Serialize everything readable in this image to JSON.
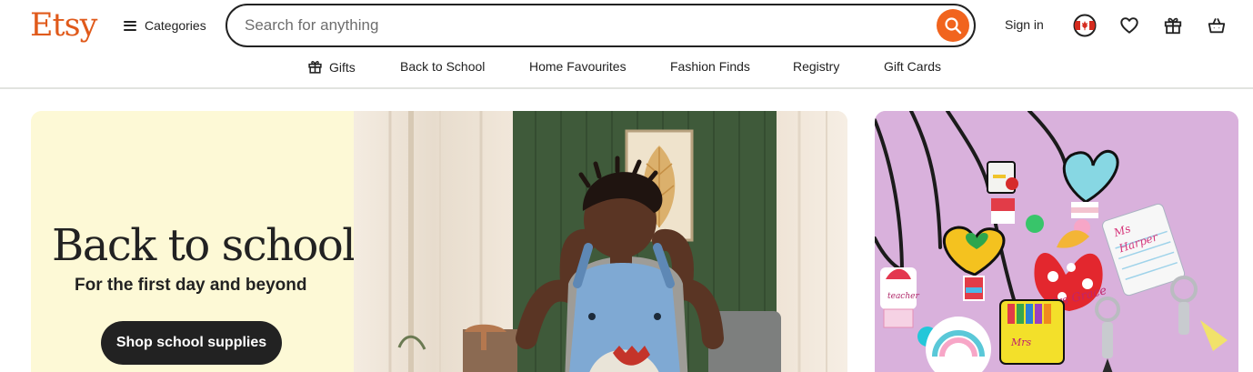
{
  "header": {
    "logo": "Etsy",
    "categories_label": "Categories",
    "search_placeholder": "Search for anything",
    "signin_label": "Sign in"
  },
  "nav": {
    "items": [
      "Gifts",
      "Back to School",
      "Home Favourites",
      "Fashion Finds",
      "Registry",
      "Gift Cards"
    ]
  },
  "hero": {
    "title": "Back to school",
    "subtitle": "For the first day and beyond",
    "cta_label": "Shop school supplies"
  },
  "colors": {
    "brand": "#f1641e",
    "logo": "#e05a1b",
    "hero_bg": "#fdf9d6",
    "side_card_bg": "#d9b1dc"
  },
  "icons": [
    "hamburger-icon",
    "search-icon",
    "canada-flag-icon",
    "heart-icon",
    "gift-icon",
    "basket-icon"
  ]
}
